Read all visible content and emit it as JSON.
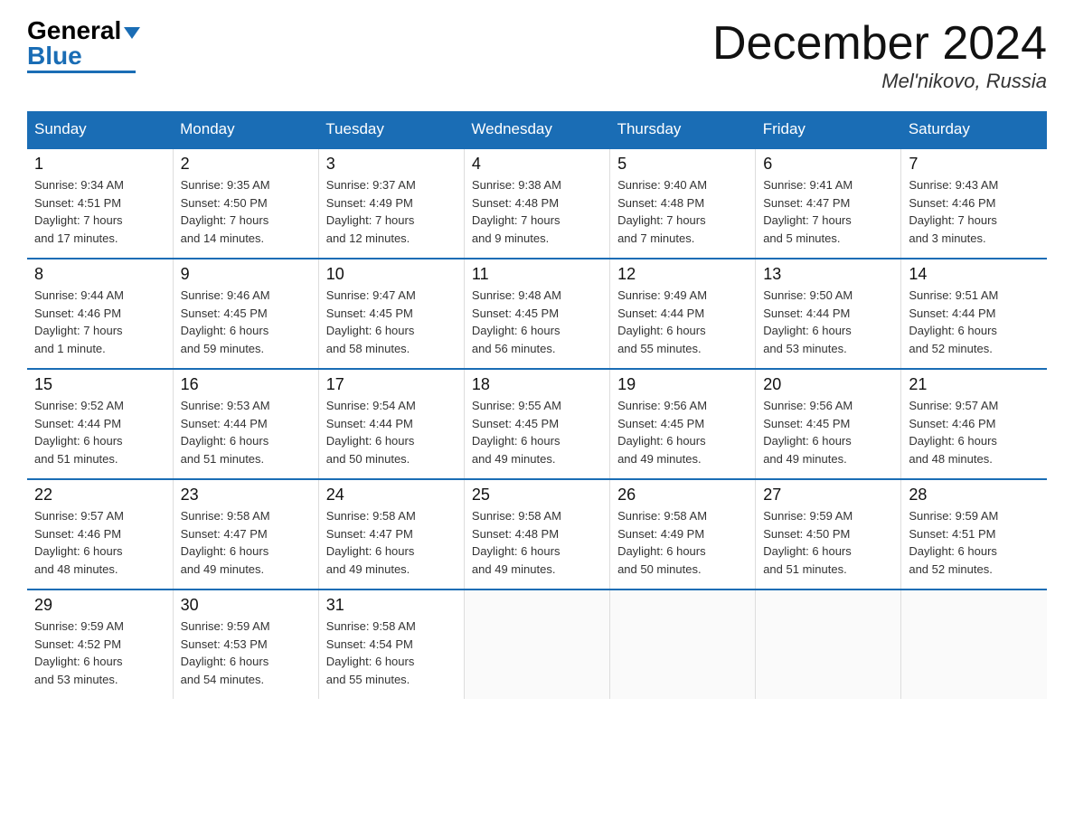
{
  "logo": {
    "general": "General",
    "blue": "Blue"
  },
  "title": "December 2024",
  "location": "Mel'nikovo, Russia",
  "weekdays": [
    "Sunday",
    "Monday",
    "Tuesday",
    "Wednesday",
    "Thursday",
    "Friday",
    "Saturday"
  ],
  "weeks": [
    [
      {
        "day": "1",
        "info": "Sunrise: 9:34 AM\nSunset: 4:51 PM\nDaylight: 7 hours\nand 17 minutes."
      },
      {
        "day": "2",
        "info": "Sunrise: 9:35 AM\nSunset: 4:50 PM\nDaylight: 7 hours\nand 14 minutes."
      },
      {
        "day": "3",
        "info": "Sunrise: 9:37 AM\nSunset: 4:49 PM\nDaylight: 7 hours\nand 12 minutes."
      },
      {
        "day": "4",
        "info": "Sunrise: 9:38 AM\nSunset: 4:48 PM\nDaylight: 7 hours\nand 9 minutes."
      },
      {
        "day": "5",
        "info": "Sunrise: 9:40 AM\nSunset: 4:48 PM\nDaylight: 7 hours\nand 7 minutes."
      },
      {
        "day": "6",
        "info": "Sunrise: 9:41 AM\nSunset: 4:47 PM\nDaylight: 7 hours\nand 5 minutes."
      },
      {
        "day": "7",
        "info": "Sunrise: 9:43 AM\nSunset: 4:46 PM\nDaylight: 7 hours\nand 3 minutes."
      }
    ],
    [
      {
        "day": "8",
        "info": "Sunrise: 9:44 AM\nSunset: 4:46 PM\nDaylight: 7 hours\nand 1 minute."
      },
      {
        "day": "9",
        "info": "Sunrise: 9:46 AM\nSunset: 4:45 PM\nDaylight: 6 hours\nand 59 minutes."
      },
      {
        "day": "10",
        "info": "Sunrise: 9:47 AM\nSunset: 4:45 PM\nDaylight: 6 hours\nand 58 minutes."
      },
      {
        "day": "11",
        "info": "Sunrise: 9:48 AM\nSunset: 4:45 PM\nDaylight: 6 hours\nand 56 minutes."
      },
      {
        "day": "12",
        "info": "Sunrise: 9:49 AM\nSunset: 4:44 PM\nDaylight: 6 hours\nand 55 minutes."
      },
      {
        "day": "13",
        "info": "Sunrise: 9:50 AM\nSunset: 4:44 PM\nDaylight: 6 hours\nand 53 minutes."
      },
      {
        "day": "14",
        "info": "Sunrise: 9:51 AM\nSunset: 4:44 PM\nDaylight: 6 hours\nand 52 minutes."
      }
    ],
    [
      {
        "day": "15",
        "info": "Sunrise: 9:52 AM\nSunset: 4:44 PM\nDaylight: 6 hours\nand 51 minutes."
      },
      {
        "day": "16",
        "info": "Sunrise: 9:53 AM\nSunset: 4:44 PM\nDaylight: 6 hours\nand 51 minutes."
      },
      {
        "day": "17",
        "info": "Sunrise: 9:54 AM\nSunset: 4:44 PM\nDaylight: 6 hours\nand 50 minutes."
      },
      {
        "day": "18",
        "info": "Sunrise: 9:55 AM\nSunset: 4:45 PM\nDaylight: 6 hours\nand 49 minutes."
      },
      {
        "day": "19",
        "info": "Sunrise: 9:56 AM\nSunset: 4:45 PM\nDaylight: 6 hours\nand 49 minutes."
      },
      {
        "day": "20",
        "info": "Sunrise: 9:56 AM\nSunset: 4:45 PM\nDaylight: 6 hours\nand 49 minutes."
      },
      {
        "day": "21",
        "info": "Sunrise: 9:57 AM\nSunset: 4:46 PM\nDaylight: 6 hours\nand 48 minutes."
      }
    ],
    [
      {
        "day": "22",
        "info": "Sunrise: 9:57 AM\nSunset: 4:46 PM\nDaylight: 6 hours\nand 48 minutes."
      },
      {
        "day": "23",
        "info": "Sunrise: 9:58 AM\nSunset: 4:47 PM\nDaylight: 6 hours\nand 49 minutes."
      },
      {
        "day": "24",
        "info": "Sunrise: 9:58 AM\nSunset: 4:47 PM\nDaylight: 6 hours\nand 49 minutes."
      },
      {
        "day": "25",
        "info": "Sunrise: 9:58 AM\nSunset: 4:48 PM\nDaylight: 6 hours\nand 49 minutes."
      },
      {
        "day": "26",
        "info": "Sunrise: 9:58 AM\nSunset: 4:49 PM\nDaylight: 6 hours\nand 50 minutes."
      },
      {
        "day": "27",
        "info": "Sunrise: 9:59 AM\nSunset: 4:50 PM\nDaylight: 6 hours\nand 51 minutes."
      },
      {
        "day": "28",
        "info": "Sunrise: 9:59 AM\nSunset: 4:51 PM\nDaylight: 6 hours\nand 52 minutes."
      }
    ],
    [
      {
        "day": "29",
        "info": "Sunrise: 9:59 AM\nSunset: 4:52 PM\nDaylight: 6 hours\nand 53 minutes."
      },
      {
        "day": "30",
        "info": "Sunrise: 9:59 AM\nSunset: 4:53 PM\nDaylight: 6 hours\nand 54 minutes."
      },
      {
        "day": "31",
        "info": "Sunrise: 9:58 AM\nSunset: 4:54 PM\nDaylight: 6 hours\nand 55 minutes."
      },
      {
        "day": "",
        "info": ""
      },
      {
        "day": "",
        "info": ""
      },
      {
        "day": "",
        "info": ""
      },
      {
        "day": "",
        "info": ""
      }
    ]
  ]
}
